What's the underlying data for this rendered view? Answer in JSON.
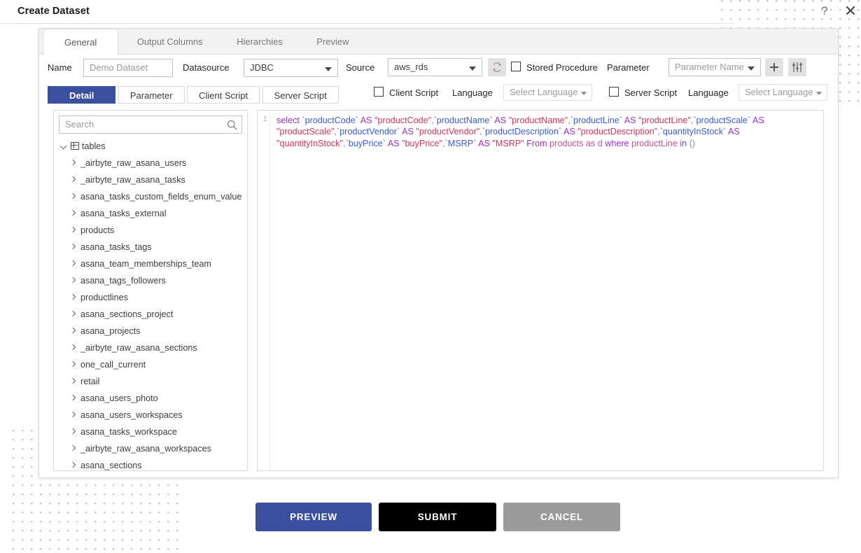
{
  "window": {
    "title": "Create Dataset",
    "help_icon": "question-mark-icon",
    "close_icon": "close-icon"
  },
  "tabs": [
    {
      "label": "General",
      "active": true
    },
    {
      "label": "Output Columns",
      "active": false
    },
    {
      "label": "Hierarchies",
      "active": false
    },
    {
      "label": "Preview",
      "active": false
    }
  ],
  "form": {
    "name_label": "Name",
    "name_value": "Demo Dataset",
    "name_placeholder": "Demo Dataset",
    "datasource_label": "Datasource",
    "datasource_value": "JDBC",
    "source_label": "Source",
    "source_value": "aws_rds",
    "refresh_icon": "refresh-icon",
    "stored_procedure_label": "Stored Procedure",
    "stored_procedure_checked": false,
    "parameter_label": "Parameter",
    "parameter_name_placeholder": "Parameter Name",
    "add_icon": "plus-icon",
    "settings_icon": "sliders-icon"
  },
  "subtabs": [
    {
      "label": "Detail",
      "active": true
    },
    {
      "label": "Parameter",
      "active": false
    },
    {
      "label": "Client Script",
      "active": false
    },
    {
      "label": "Server Script",
      "active": false
    }
  ],
  "script_options": {
    "client_script_label": "Client Script",
    "client_script_checked": false,
    "client_language_label": "Language",
    "client_language_value": "Select Language",
    "server_script_label": "Server Script",
    "server_script_checked": false,
    "server_language_label": "Language",
    "server_language_value": "Select Language"
  },
  "sidebar": {
    "search_placeholder": "Search",
    "search_icon": "search-icon",
    "root": {
      "label": "tables",
      "icon": "table-grid-icon",
      "expanded": true
    },
    "items": [
      {
        "label": "_airbyte_raw_asana_users"
      },
      {
        "label": "_airbyte_raw_asana_tasks"
      },
      {
        "label": "asana_tasks_custom_fields_enum_value"
      },
      {
        "label": "asana_tasks_external"
      },
      {
        "label": "products"
      },
      {
        "label": "asana_tasks_tags"
      },
      {
        "label": "asana_team_memberships_team"
      },
      {
        "label": "asana_tags_followers"
      },
      {
        "label": "productlines"
      },
      {
        "label": "asana_sections_project"
      },
      {
        "label": "asana_projects"
      },
      {
        "label": "_airbyte_raw_asana_sections"
      },
      {
        "label": "one_call_current"
      },
      {
        "label": "retail"
      },
      {
        "label": "asana_users_photo"
      },
      {
        "label": "asana_users_workspaces"
      },
      {
        "label": "asana_tasks_workspace"
      },
      {
        "label": "_airbyte_raw_asana_workspaces"
      },
      {
        "label": "asana_sections"
      }
    ]
  },
  "editor": {
    "line_number": "1",
    "sql": "select `productCode` AS \"productCode\",`productName` AS \"productName\",`productLine` AS \"productLine\",`productScale` AS \"productScale\",`productVendor` AS \"productVendor\",`productDescription` AS \"productDescription\",`quantityInStock` AS \"quantityInStock\",`buyPrice` AS \"buyPrice\",`MSRP` AS \"MSRP\" From products as d where productLine in ()",
    "tokens": [
      {
        "t": "select ",
        "c": "kw"
      },
      {
        "t": "`productCode`",
        "c": "idt"
      },
      {
        "t": " AS ",
        "c": "kw"
      },
      {
        "t": "\"productCode\"",
        "c": "str"
      },
      {
        "t": ",",
        "c": "punc"
      },
      {
        "t": "`productName`",
        "c": "idt"
      },
      {
        "t": " AS ",
        "c": "kw"
      },
      {
        "t": "\"productName\"",
        "c": "str"
      },
      {
        "t": ",",
        "c": "punc"
      },
      {
        "t": "`productLine`",
        "c": "idt"
      },
      {
        "t": " AS ",
        "c": "kw"
      },
      {
        "t": "\"productLine\"",
        "c": "str"
      },
      {
        "t": ",",
        "c": "punc"
      },
      {
        "t": "`productScale`",
        "c": "idt"
      },
      {
        "t": " AS ",
        "c": "kw"
      },
      {
        "t": "\"productScale\"",
        "c": "str"
      },
      {
        "t": ",",
        "c": "punc"
      },
      {
        "t": "`productVendor`",
        "c": "idt"
      },
      {
        "t": " AS ",
        "c": "kw"
      },
      {
        "t": "\"productVendor\"",
        "c": "str"
      },
      {
        "t": ",",
        "c": "punc"
      },
      {
        "t": "`productDescription`",
        "c": "idt"
      },
      {
        "t": " AS ",
        "c": "kw"
      },
      {
        "t": "\"productDescription\"",
        "c": "str"
      },
      {
        "t": ",",
        "c": "punc"
      },
      {
        "t": "`quantityInStock`",
        "c": "idt"
      },
      {
        "t": " AS ",
        "c": "kw"
      },
      {
        "t": "\"quantityInStock\"",
        "c": "str"
      },
      {
        "t": ",",
        "c": "punc"
      },
      {
        "t": "`buyPrice`",
        "c": "idt"
      },
      {
        "t": " AS ",
        "c": "kw"
      },
      {
        "t": "\"buyPrice\"",
        "c": "str"
      },
      {
        "t": ",",
        "c": "punc"
      },
      {
        "t": "`MSRP`",
        "c": "idt"
      },
      {
        "t": " AS ",
        "c": "kw"
      },
      {
        "t": "\"MSRP\"",
        "c": "str"
      },
      {
        "t": " From ",
        "c": "kw"
      },
      {
        "t": "products as d",
        "c": "pln"
      },
      {
        "t": " where ",
        "c": "kw"
      },
      {
        "t": "productLine",
        "c": "pln"
      },
      {
        "t": " in ",
        "c": "kw"
      },
      {
        "t": "()",
        "c": "punc"
      }
    ]
  },
  "footer": {
    "preview_label": "PREVIEW",
    "submit_label": "SUBMIT",
    "cancel_label": "CANCEL"
  },
  "colors": {
    "accent_blue": "#3b4fa0",
    "submit_black": "#000000",
    "cancel_gray": "#9b9b9b",
    "dot_pattern": "#b9bfe8"
  }
}
